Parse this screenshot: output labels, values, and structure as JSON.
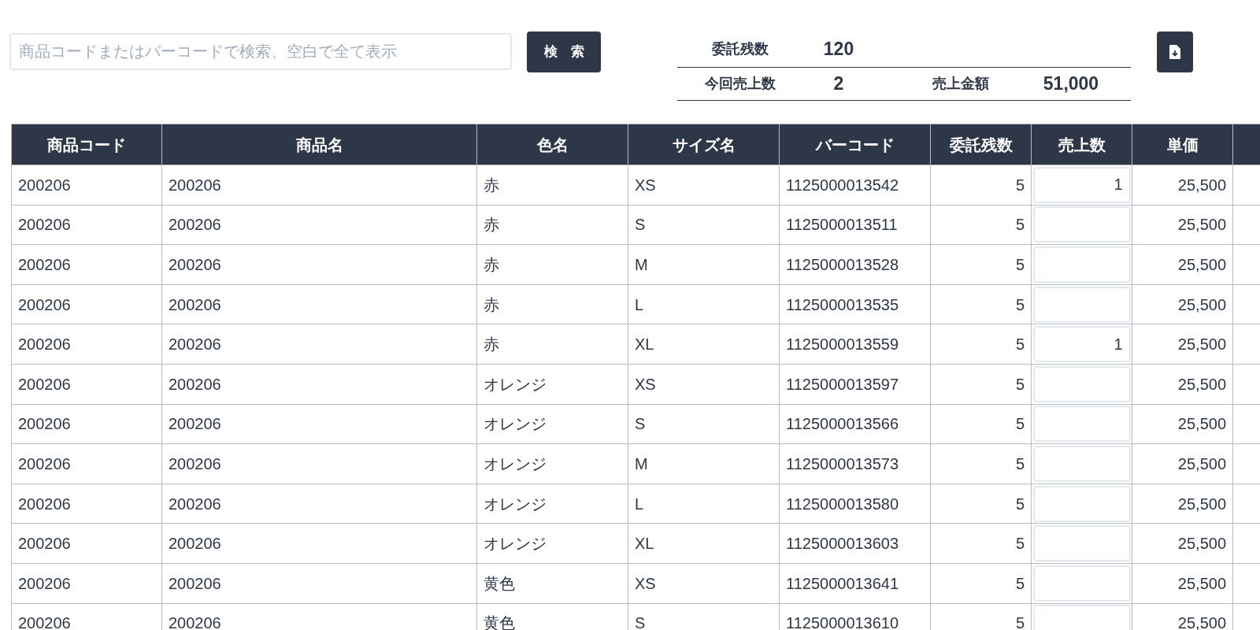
{
  "search": {
    "placeholder": "商品コードまたはバーコードで検索、空白で全て表示",
    "button": "検　索"
  },
  "summary": {
    "consign_label": "委託残数",
    "consign_value": "120",
    "sold_label": "今回売上数",
    "sold_value": "2",
    "amount_label": "売上金額",
    "amount_value": "51,000"
  },
  "table": {
    "columns": [
      "商品コード",
      "商品名",
      "色名",
      "サイズ名",
      "バーコード",
      "委託残数",
      "売上数",
      "単価"
    ],
    "rows": [
      {
        "code": "200206",
        "name": "200206",
        "color_name": "赤",
        "size": "XS",
        "barcode": "1125000013542",
        "remaining": "5",
        "sold": "1",
        "price": "25,500"
      },
      {
        "code": "200206",
        "name": "200206",
        "color_name": "赤",
        "size": "S",
        "barcode": "1125000013511",
        "remaining": "5",
        "price": "25,500"
      },
      {
        "code": "200206",
        "name": "200206",
        "color_name": "赤",
        "size": "M",
        "barcode": "1125000013528",
        "remaining": "5",
        "price": "25,500"
      },
      {
        "code": "200206",
        "name": "200206",
        "color_name": "赤",
        "size": "L",
        "barcode": "1125000013535",
        "remaining": "5",
        "price": "25,500"
      },
      {
        "code": "200206",
        "name": "200206",
        "color_name": "赤",
        "size": "XL",
        "barcode": "1125000013559",
        "remaining": "5",
        "sold": "1",
        "price": "25,500"
      },
      {
        "code": "200206",
        "name": "200206",
        "color_name": "オレンジ",
        "size": "XS",
        "barcode": "1125000013597",
        "remaining": "5",
        "price": "25,500"
      },
      {
        "code": "200206",
        "name": "200206",
        "color_name": "オレンジ",
        "size": "S",
        "barcode": "1125000013566",
        "remaining": "5",
        "price": "25,500"
      },
      {
        "code": "200206",
        "name": "200206",
        "color_name": "オレンジ",
        "size": "M",
        "barcode": "1125000013573",
        "remaining": "5",
        "price": "25,500"
      },
      {
        "code": "200206",
        "name": "200206",
        "color_name": "オレンジ",
        "size": "L",
        "barcode": "1125000013580",
        "remaining": "5",
        "price": "25,500"
      },
      {
        "code": "200206",
        "name": "200206",
        "color_name": "オレンジ",
        "size": "XL",
        "barcode": "1125000013603",
        "remaining": "5",
        "price": "25,500"
      },
      {
        "code": "200206",
        "name": "200206",
        "color_name": "黄色",
        "size": "XS",
        "barcode": "1125000013641",
        "remaining": "5",
        "price": "25,500"
      },
      {
        "code": "200206",
        "name": "200206",
        "color_name": "黄色",
        "size": "S",
        "barcode": "1125000013610",
        "remaining": "5",
        "price": "25,500"
      }
    ]
  }
}
